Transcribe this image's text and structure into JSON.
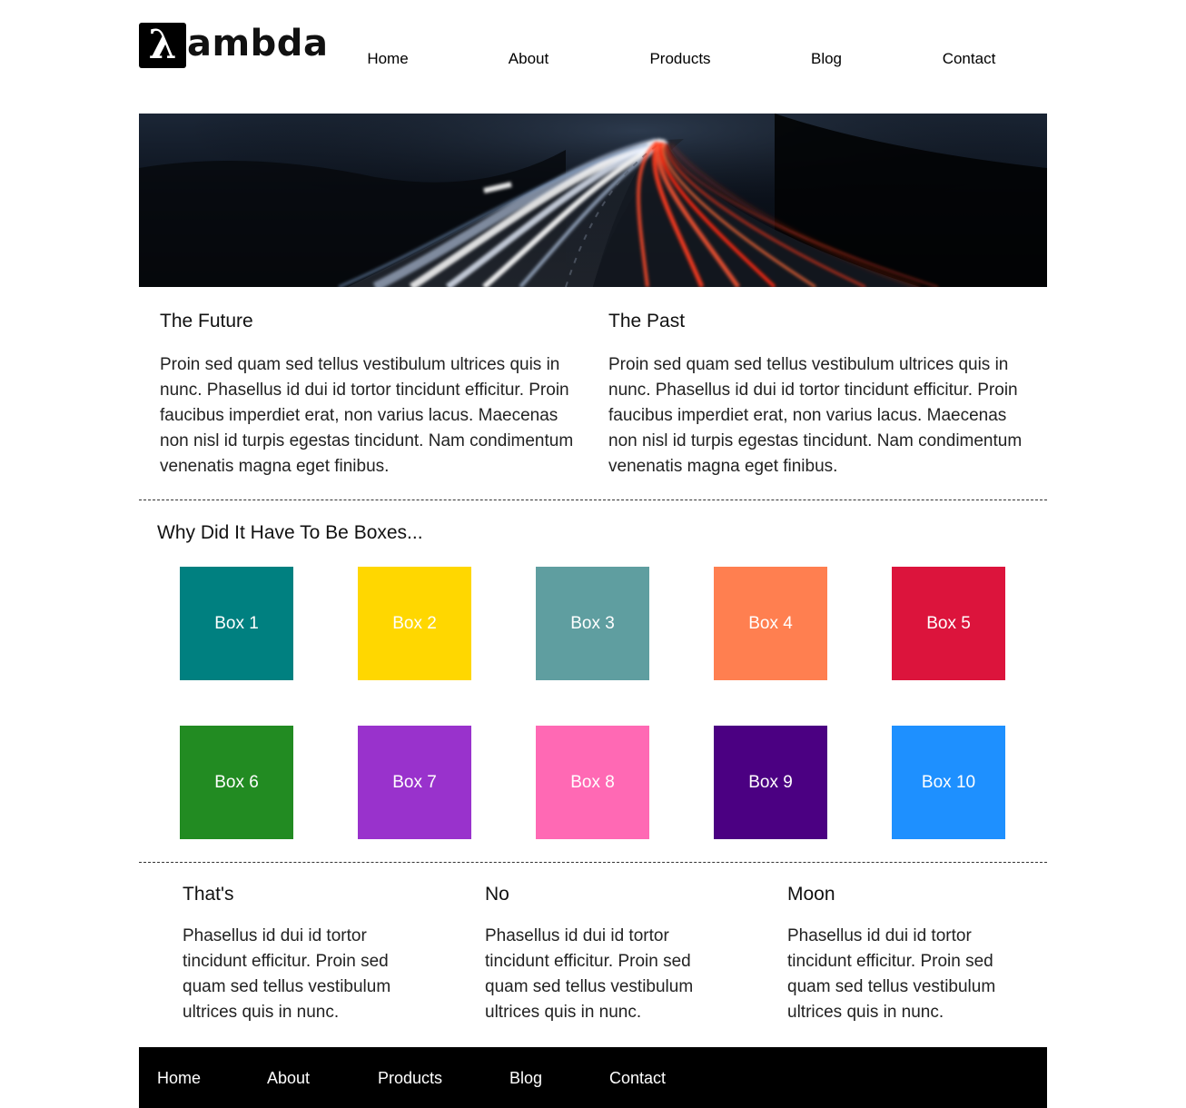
{
  "logo": {
    "symbol": "λ",
    "text": "ambda"
  },
  "nav": {
    "items": [
      "Home",
      "About",
      "Products",
      "Blog",
      "Contact"
    ]
  },
  "intro": [
    {
      "title": "The Future",
      "text": "Proin sed quam sed tellus vestibulum ultrices quis in nunc. Phasellus id dui id tortor tincidunt efficitur. Proin faucibus imperdiet erat, non varius lacus. Maecenas non nisl id turpis egestas tincidunt. Nam condimentum venenatis magna eget finibus."
    },
    {
      "title": "The Past",
      "text": "Proin sed quam sed tellus vestibulum ultrices quis in nunc. Phasellus id dui id tortor tincidunt efficitur. Proin faucibus imperdiet erat, non varius lacus. Maecenas non nisl id turpis egestas tincidunt. Nam condimentum venenatis magna eget finibus."
    }
  ],
  "boxes_section": {
    "title": "Why Did It Have To Be Boxes...",
    "boxes": [
      {
        "label": "Box 1",
        "color": "#008080"
      },
      {
        "label": "Box 2",
        "color": "#FFD700"
      },
      {
        "label": "Box 3",
        "color": "#5F9EA0"
      },
      {
        "label": "Box 4",
        "color": "#FF7F50"
      },
      {
        "label": "Box 5",
        "color": "#DC143C"
      },
      {
        "label": "Box 6",
        "color": "#228B22"
      },
      {
        "label": "Box 7",
        "color": "#9932CC"
      },
      {
        "label": "Box 8",
        "color": "#FF69B4"
      },
      {
        "label": "Box 9",
        "color": "#4B0082"
      },
      {
        "label": "Box 10",
        "color": "#1E90FF"
      }
    ]
  },
  "bottom": [
    {
      "title": "That's",
      "text": "Phasellus id dui id tortor tincidunt efficitur. Proin sed quam sed tellus vestibulum ultrices quis in nunc."
    },
    {
      "title": "No",
      "text": "Phasellus id dui id tortor tincidunt efficitur. Proin sed quam sed tellus vestibulum ultrices quis in nunc."
    },
    {
      "title": "Moon",
      "text": "Phasellus id dui id tortor tincidunt efficitur. Proin sed quam sed tellus vestibulum ultrices quis in nunc."
    }
  ],
  "footer_nav": {
    "items": [
      "Home",
      "About",
      "Products",
      "Blog",
      "Contact"
    ]
  }
}
